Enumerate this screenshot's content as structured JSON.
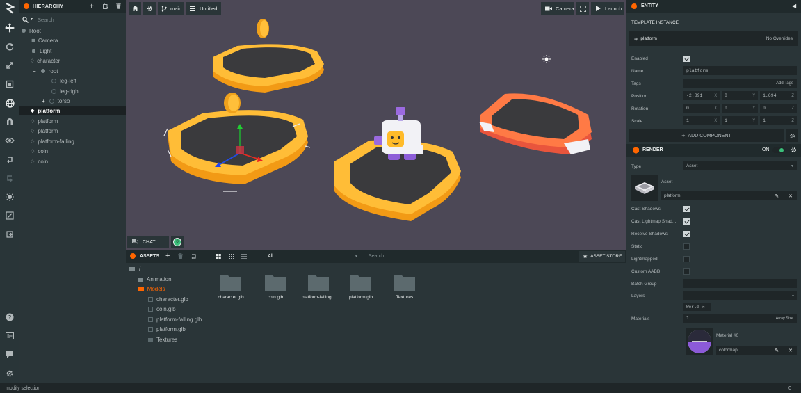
{
  "hierarchy": {
    "title": "HIERARCHY",
    "search_placeholder": "Search",
    "items": [
      {
        "label": "Root"
      },
      {
        "label": "Camera"
      },
      {
        "label": "Light"
      },
      {
        "label": "character",
        "expander": "−"
      },
      {
        "label": "root",
        "expander": "−"
      },
      {
        "label": "leg-left"
      },
      {
        "label": "leg-right"
      },
      {
        "label": "torso",
        "expander": "+"
      },
      {
        "label": "platform"
      },
      {
        "label": "platform"
      },
      {
        "label": "platform"
      },
      {
        "label": "platform-falling"
      },
      {
        "label": "coin"
      },
      {
        "label": "coin"
      }
    ]
  },
  "viewport": {
    "branch": "main",
    "scene": "Untitled",
    "camera_label": "Camera",
    "launch_label": "Launch",
    "chat_label": "CHAT",
    "chat_count": "0"
  },
  "assets": {
    "title": "ASSETS",
    "filter_value": "All",
    "search_placeholder": "Search",
    "store_label": "ASSET STORE",
    "tree": [
      {
        "label": "/"
      },
      {
        "label": "Animation"
      },
      {
        "label": "Models",
        "expander": "−"
      },
      {
        "label": "character.glb"
      },
      {
        "label": "coin.glb"
      },
      {
        "label": "platform-falling.glb"
      },
      {
        "label": "platform.glb"
      },
      {
        "label": "Textures"
      }
    ],
    "grid": [
      {
        "label": "character.glb"
      },
      {
        "label": "coin.glb"
      },
      {
        "label": "platform-falling..."
      },
      {
        "label": "platform.glb"
      },
      {
        "label": "Textures"
      }
    ]
  },
  "inspector": {
    "title": "ENTITY",
    "template_title": "TEMPLATE INSTANCE",
    "template_name": "platform",
    "template_overrides": "No Overrides",
    "enabled_label": "Enabled",
    "name_label": "Name",
    "name_value": "platform",
    "tags_label": "Tags",
    "add_tags": "Add Tags",
    "position_label": "Position",
    "position": [
      "-2.891",
      "0",
      "1.694"
    ],
    "rotation_label": "Rotation",
    "rotation": [
      "0",
      "0",
      "0"
    ],
    "scale_label": "Scale",
    "scale": [
      "1",
      "1",
      "1"
    ],
    "axes": [
      "X",
      "Y",
      "Z"
    ],
    "add_component": "ADD COMPONENT",
    "render_title": "RENDER",
    "render_toggle": "ON",
    "type_label": "Type",
    "type_value": "Asset",
    "asset_label": "Asset",
    "asset_value": "platform",
    "cast_shadows": "Cast Shadows",
    "cast_lightmap": "Cast Lightmap Shad...",
    "receive_shadows": "Receive Shadows",
    "static": "Static",
    "lightmapped": "Lightmapped",
    "custom_aabb": "Custom AABB",
    "batch_group": "Batch Group",
    "layers_label": "Layers",
    "layer_tag": "World",
    "materials_label": "Materials",
    "materials_count": "1",
    "array_size": "Array Size",
    "material_name": "Material #0",
    "material_value": "colormap"
  },
  "status": {
    "text": "modify selection",
    "right": "0"
  },
  "colors": {
    "accent": "#ff6600",
    "panel": "#2a3538",
    "viewport": "#4c4856",
    "platform": "#ffb833"
  }
}
